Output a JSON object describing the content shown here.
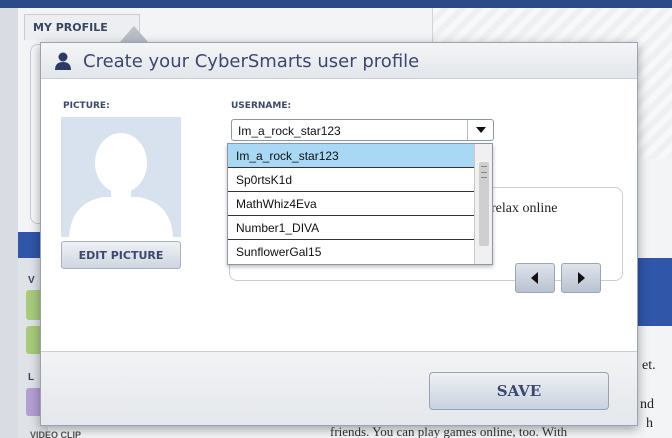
{
  "background": {
    "tab_label": "MY PROFILE",
    "left_letters": [
      "V",
      "L"
    ],
    "right_snippets": [
      "et.",
      "nd",
      "h"
    ],
    "bottom_text": "friends. You can play games online, too. With",
    "video_label": "VIDEO CLIP"
  },
  "carousel": {
    "text": "relax online",
    "prev_icon": "chevron-left-icon",
    "next_icon": "chevron-right-icon"
  },
  "modal": {
    "icon": "user-icon",
    "title": "Create your CyberSmarts user profile",
    "picture_label": "PICTURE:",
    "edit_picture_label": "EDIT PICTURE",
    "username_label": "USERNAME:",
    "username_value": "Im_a_rock_star123",
    "username_options": [
      "Im_a_rock_star123",
      "Sp0rtsK1d",
      "MathWhiz4Eva",
      "Number1_DIVA",
      "SunflowerGal15"
    ],
    "selected_option_index": 0,
    "save_label": "SAVE"
  },
  "colors": {
    "accent_blue": "#2f56a8",
    "title_text": "#3b4870",
    "selected_option": "#a9d8f5"
  }
}
